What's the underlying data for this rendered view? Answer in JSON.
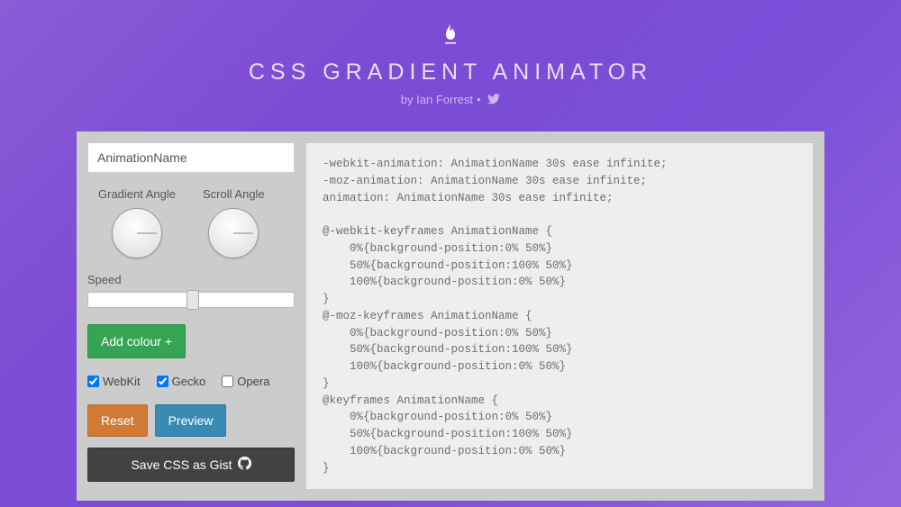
{
  "header": {
    "title": "CSS GRADIENT ANIMATOR",
    "byline_prefix": "by ",
    "author": "Ian Forrest"
  },
  "controls": {
    "name_value": "AnimationName",
    "gradient_angle_label": "Gradient Angle",
    "scroll_angle_label": "Scroll Angle",
    "speed_label": "Speed",
    "add_colour_label": "Add colour +",
    "checks": {
      "webkit": {
        "label": "WebKit",
        "checked": true
      },
      "gecko": {
        "label": "Gecko",
        "checked": true
      },
      "opera": {
        "label": "Opera",
        "checked": false
      }
    },
    "reset_label": "Reset",
    "preview_label": "Preview",
    "gist_label": "Save CSS as Gist"
  },
  "code": "-webkit-animation: AnimationName 30s ease infinite;\n-moz-animation: AnimationName 30s ease infinite;\nanimation: AnimationName 30s ease infinite;\n\n@-webkit-keyframes AnimationName {\n    0%{background-position:0% 50%}\n    50%{background-position:100% 50%}\n    100%{background-position:0% 50%}\n}\n@-moz-keyframes AnimationName {\n    0%{background-position:0% 50%}\n    50%{background-position:100% 50%}\n    100%{background-position:0% 50%}\n}\n@keyframes AnimationName {\n    0%{background-position:0% 50%}\n    50%{background-position:100% 50%}\n    100%{background-position:0% 50%}\n}"
}
